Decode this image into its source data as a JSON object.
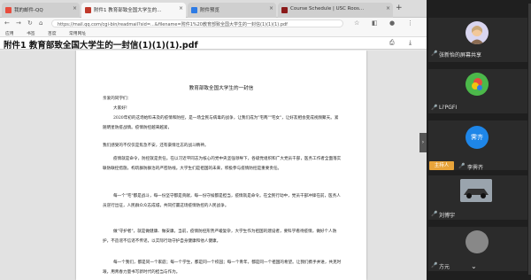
{
  "browser": {
    "tabs": [
      {
        "label": "我的邮件-QQ",
        "color": "#e84c3d"
      },
      {
        "label": "附件1 教育部致全国大学生的...",
        "color": "#c0392b"
      },
      {
        "label": "附件预览",
        "color": "#2d7be5"
      },
      {
        "label": "Course Schedule | USC Roos...",
        "color": "#8b1a1a"
      }
    ],
    "address": "https://mail.qq.com/cgi-bin/readmail?sid=...&filename=附件1%20教育部致全国大学生的一封信(1)(1)(1).pdf",
    "bookmarks": [
      "应用",
      "书签",
      "百度",
      "常用网址"
    ]
  },
  "document": {
    "title": "附件1 教育部致全国大学生的一封信(1)(1)(1).pdf",
    "letter_title": "教育部致全国大学生的一封信",
    "paragraphs": [
      "亲爱的同学们：",
      "大家好！",
      "2020年初的这场始料未及的疫情和防控，是一场全民与病毒的战争，让我们成为\"宅两\"\"宅女\"，让好友相会变成视频聚天。紧随明星防疫战情。疫情防控越来越紧，",
      "我们感受的不仅仅是焦急不安，还有豪情壮志的战斗精神。",
      "疫情就是命令，防控就是责任。在以习近平同志为核心的党中央坚强领导下，各级党组织和广大党员干部，医务工作者全面落实联防联控措施，构筑群防群治的严密防线。大学生们是祖国的未来，积极参与疫情防控是重要责任。",
      "每一个\"宅\"都是战斗，每一份坚守都是贡献，每一份守候都是担当，疫情就是命令。在全民行动中，党员干部冲锋在前，医务人员逆行出征，人民群众众志成城，共同打赢这场疫情防控的人民战争。",
      "做\"守护者\"，就是做健康、做安康。当前，疫情防控形势严峻复杂，大学生作为祖国的建设者，要科学看待疫情，做好个人防护，不造谣不信谣不传谣，以实际行动守护自身健康和他人健康。",
      "每一个我们，都是同一个家庭；每一个学生，都是同一个校园；每一个青年，都是同一个祖国的希望。让我们携手并进，共克时艰，用青春力量书写新时代的担当与作为。"
    ]
  },
  "participants": [
    {
      "name": "张新怡的屏幕共享",
      "avatar_color": "#d9d6f0"
    },
    {
      "name": "Li'PGFI",
      "avatar_color": "#3aa840"
    },
    {
      "name": "李霁齐",
      "avatar_color": "#1e86e8",
      "avatar_text": "霁齐",
      "host_label": "主持人"
    },
    {
      "name": "刘博宇",
      "avatar_color": "#b0b0b0"
    },
    {
      "name": "方元",
      "avatar_color": "#888"
    }
  ]
}
